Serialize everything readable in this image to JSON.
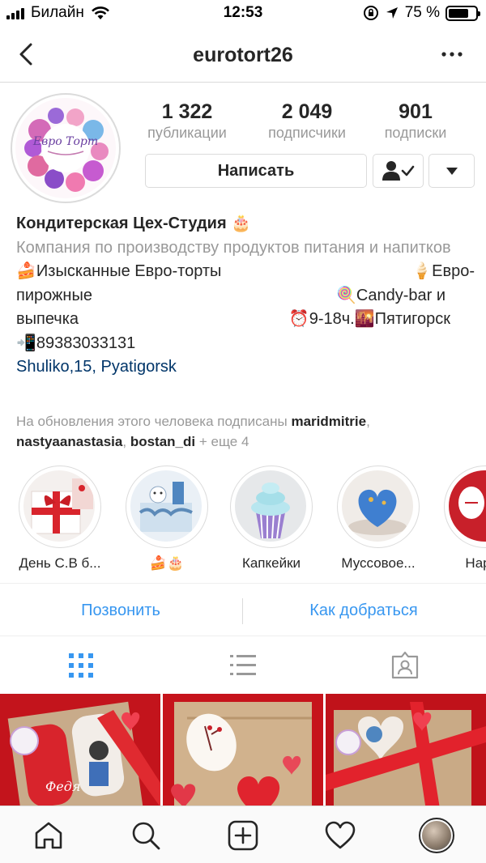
{
  "status_bar": {
    "carrier": "Билайн",
    "time": "12:53",
    "battery": "75 %",
    "battery_level": 0.75
  },
  "nav": {
    "title": "eurotort26"
  },
  "profile": {
    "avatar_text": "Евро Торт",
    "stats": [
      {
        "value": "1 322",
        "label": "публикации"
      },
      {
        "value": "2 049",
        "label": "подписчики"
      },
      {
        "value": "901",
        "label": "подписки"
      }
    ],
    "message_button": "Написать"
  },
  "bio": {
    "name": "Кондитерская Цех-Студия 🎂",
    "category": "Компания по производству продуктов питания и напитков",
    "line1_left": "🍰Изысканные Евро-торты",
    "line1_right": "🍦Евро-",
    "line2_left": "пирожные",
    "line2_right": "🍭Candy-bar и",
    "line3_left": "выпечка",
    "line3_right": "⏰9-18ч.🌇Пятигорск",
    "phone": "📲89383033131",
    "address": "Shuliko,15, Pyatigorsk"
  },
  "followed_by": {
    "prefix": "На обновления этого человека подписаны",
    "user1": "maridmitrie",
    "user2": "nastyaanastasia",
    "user3": "bostan_di",
    "suffix": "+ еще 4"
  },
  "highlights": [
    {
      "label": "День С.В б..."
    },
    {
      "label": "🍰🎂"
    },
    {
      "label": "Капкейки"
    },
    {
      "label": "Муссовое..."
    },
    {
      "label": "Happy"
    }
  ],
  "actions": {
    "call": "Позвонить",
    "directions": "Как добраться"
  },
  "grid": [
    {
      "caption_text": "Федя"
    },
    {
      "caption_text": ""
    },
    {
      "caption_text": ""
    }
  ],
  "colors": {
    "link_blue": "#3897f0",
    "address_blue": "#003569",
    "muted_gray": "#999999",
    "border": "#dbdbdb",
    "text": "#262626"
  }
}
